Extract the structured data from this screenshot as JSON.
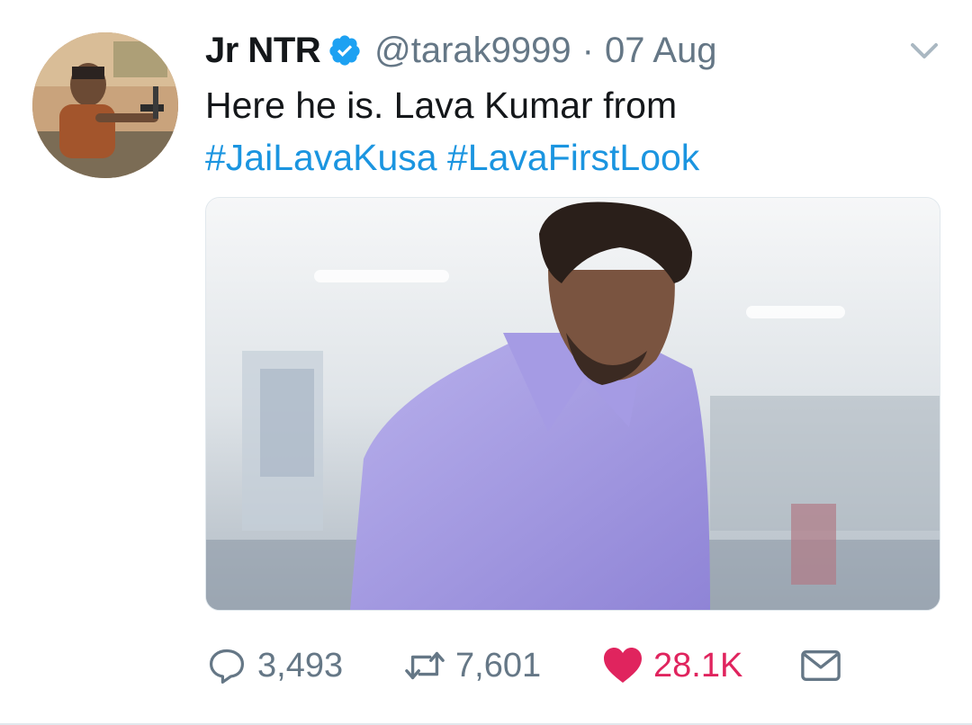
{
  "tweet": {
    "author_name": "Jr NTR",
    "handle": "@tarak9999",
    "separator": "·",
    "date": "07 Aug",
    "text_line1": "Here he is. Lava Kumar from",
    "hashtag1": "#JaiLavaKusa",
    "hashtag2": "#LavaFirstLook",
    "verified": true
  },
  "actions": {
    "reply_count": "3,493",
    "retweet_count": "7,601",
    "like_count": "28.1K",
    "liked": true
  },
  "icons": {
    "verified": "verified-badge-icon",
    "caret": "chevron-down-icon",
    "reply": "reply-icon",
    "retweet": "retweet-icon",
    "like": "heart-icon",
    "message": "envelope-icon"
  },
  "colors": {
    "link": "#1b95e0",
    "muted": "#657786",
    "like": "#e0245e",
    "text": "#14171a"
  }
}
